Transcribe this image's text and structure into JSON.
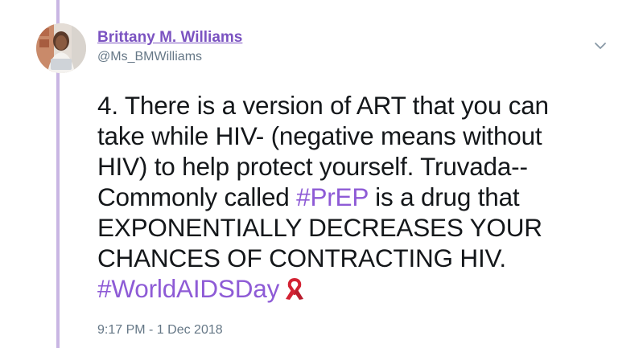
{
  "author": {
    "display_name": "Brittany M. Williams",
    "handle": "@Ms_BMWilliams"
  },
  "tweet": {
    "line1": "4. There is a version of ART that you can",
    "line2": "take while HIV- (negative means without",
    "line3": "HIV) to help protect yourself. Truvada--",
    "line4_before": "Commonly called ",
    "hashtag_prep": "#PrEP",
    "line4_after": " is a drug that",
    "line5": "EXPONENTIALLY DECREASES YOUR",
    "line6": "CHANCES OF CONTRACTING HIV.",
    "hashtag_worldaidsday": "#WorldAIDSDay",
    "emoji": "red-ribbon-icon"
  },
  "timestamp": "9:17 PM - 1 Dec 2018",
  "icons": {
    "menu": "chevron-down-icon",
    "avatar": "profile-photo"
  },
  "colors": {
    "link": "#7b53c1",
    "hashtag": "#8e5bd6",
    "thread_line": "#c9b6e3",
    "secondary_text": "#657786",
    "body_text": "#14171a",
    "ribbon": "#d32233"
  }
}
